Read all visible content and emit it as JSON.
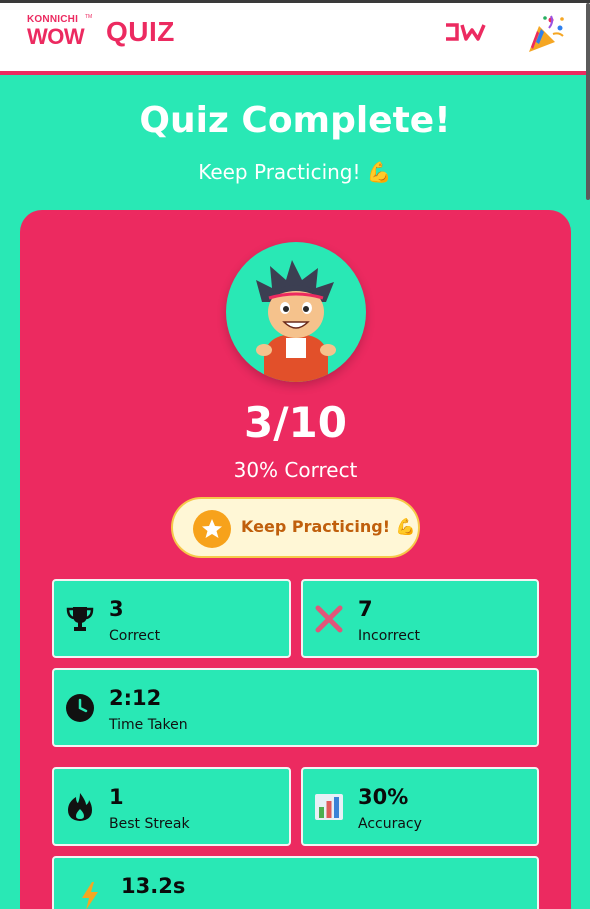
{
  "header": {
    "brand_top": "KONNICHI",
    "brand_bottom": "WOW",
    "brand_tm": "TM",
    "title": "QUIZ",
    "partner_logo_icon": "jw-logo",
    "party_icon": "party-popper-icon"
  },
  "result": {
    "headline": "Quiz Complete!",
    "message": "Keep Practicing! 💪",
    "score": "3/10",
    "percent_text": "30% Correct",
    "badge_label": "Keep Practicing! 💪",
    "badge_icon": "star-icon"
  },
  "stats": {
    "correct": {
      "value": "3",
      "label": "Correct",
      "icon": "trophy-icon"
    },
    "incorrect": {
      "value": "7",
      "label": "Incorrect",
      "icon": "cross-mark-icon"
    },
    "time": {
      "value": "2:12",
      "label": "Time Taken",
      "icon": "clock-icon"
    },
    "streak": {
      "value": "1",
      "label": "Best Streak",
      "icon": "fire-icon"
    },
    "accuracy": {
      "value": "30%",
      "label": "Accuracy",
      "icon": "bar-chart-icon"
    },
    "avg_time": {
      "value": "13.2s",
      "label": "",
      "icon": "lightning-icon"
    }
  },
  "colors": {
    "background": "#29e8b5",
    "accent": "#ec2a60",
    "badge_bg": "#fff7d6",
    "badge_text": "#c05f0c"
  }
}
